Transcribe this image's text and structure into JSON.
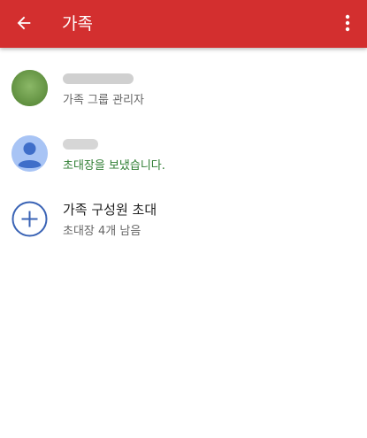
{
  "appbar": {
    "title": "가족",
    "back_icon": "arrow-back-icon",
    "menu_icon": "more-vertical-icon",
    "color": "#d32f2f"
  },
  "members": [
    {
      "name": "",
      "role": "가족 그룹 관리자",
      "avatar_color": "#6a9a46"
    },
    {
      "name": "",
      "status": "초대장을 보냈습니다.",
      "status_color": "#2e7d32",
      "avatar_color": "#a8c4f5"
    }
  ],
  "invite": {
    "title": "가족 구성원 초대",
    "subtitle": "초대장 4개 남음",
    "icon": "add-circle-icon",
    "icon_color": "#3a63b5"
  }
}
